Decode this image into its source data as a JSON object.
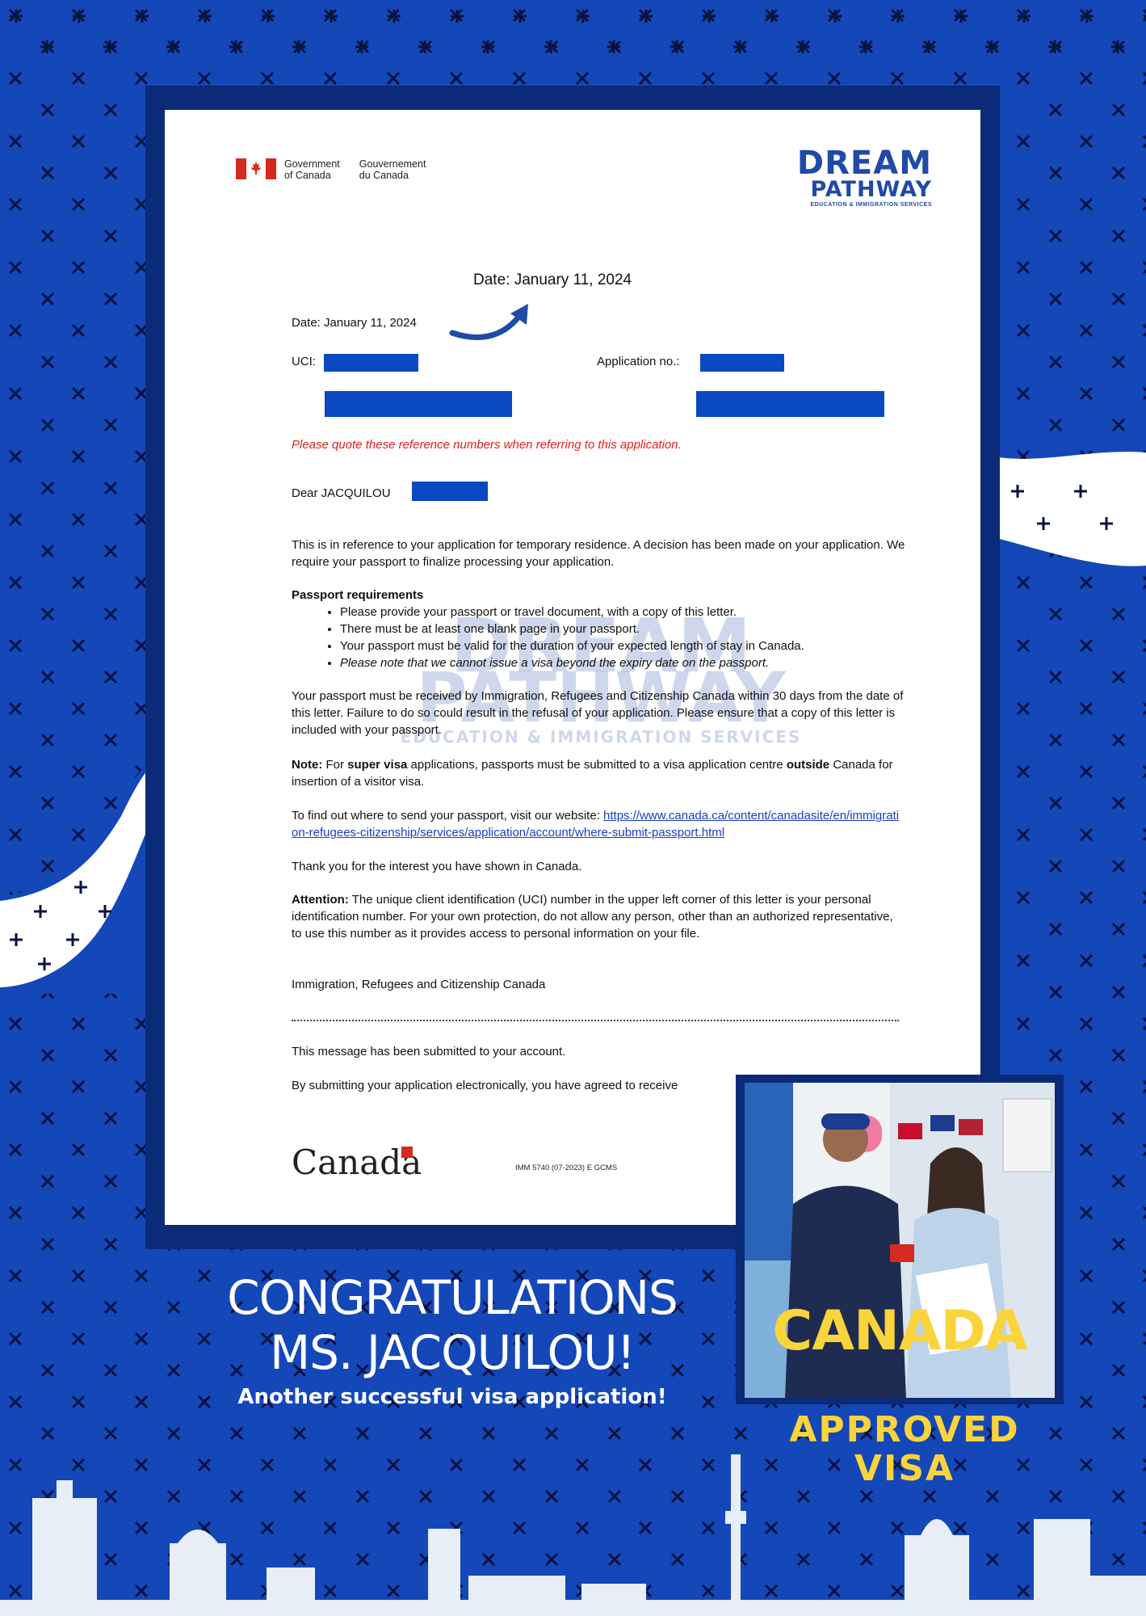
{
  "letter": {
    "gov_en_line1": "Government",
    "gov_en_line2": "of Canada",
    "gov_fr_line1": "Gouvernement",
    "gov_fr_line2": "du Canada",
    "brand_line1": "DREAM",
    "brand_line2": "PATHWAY",
    "brand_sub": "EDUCATION & IMMIGRATION SERVICES",
    "date_callout": "Date:  January 11, 2024",
    "date": "Date:  January 11, 2024",
    "uci_label": "UCI:",
    "application_label": "Application no.:",
    "quote_notice": "Please quote these reference numbers when referring to this application.",
    "dear": "Dear  JACQUILOU",
    "para_reference": "This is in reference to your application for temporary residence. A decision has been made on your application. We require your passport to finalize processing your application.",
    "passport_heading": "Passport requirements",
    "req_items": [
      "Please provide your passport or travel document, with a copy of this letter.",
      "There must be at least one blank page in your passport.",
      "Your passport must be valid for the duration of your expected length of stay in Canada.",
      "Please note that we cannot issue a visa beyond the expiry date on the passport."
    ],
    "para_received": "Your passport must be received by Immigration, Refugees and Citizenship Canada within 30 days from the date of this letter. Failure to do so could result in the refusal of your application. Please ensure that a copy of this letter is included with your passport.",
    "note_label": "Note:",
    "note_text_a": " For ",
    "note_bold_a": "super visa",
    "note_text_b": " applications, passports must be submitted to a visa application centre ",
    "note_bold_b": "outside",
    "note_text_c": " Canada for insertion of a visitor visa.",
    "find_text": "To find out where to send your passport, visit our website: ",
    "find_link": "https://www.canada.ca/content/canadasite/en/immigration-refugees-citizenship/services/application/account/where-submit-passport.html",
    "thank_you": "Thank you for the interest you have shown in Canada.",
    "attention_label": "Attention:",
    "attention_text": "  The unique client identification (UCI) number in the upper left corner of this letter is your personal identification number. For your own protection, do not allow any person, other than an authorized representative, to use this number as it provides access to personal information on your file.",
    "signoff": "Immigration, Refugees and Citizenship Canada",
    "submitted": "This message has been submitted to your account.",
    "electronic": "By submitting your application electronically, you have agreed to receive",
    "canada_wordmark": "Canada",
    "form_code": "IMM 5740 (07-2023) E GCMS"
  },
  "watermark": {
    "line1": "DREAM",
    "line2": "PATHWAY",
    "line3": "EDUCATION & IMMIGRATION SERVICES"
  },
  "banner": {
    "headline_1": "CONGRATULATIONS",
    "headline_2": "MS. JACQUILOU!",
    "subline": "Another successful visa application!"
  },
  "photo": {
    "country": "CANADA",
    "approved_1": "APPROVED",
    "approved_2": "VISA"
  },
  "colors": {
    "background": "#1447b8",
    "frame": "#0b2a78",
    "accent_yellow": "#fbd33b",
    "notice_red": "#e0201b"
  }
}
